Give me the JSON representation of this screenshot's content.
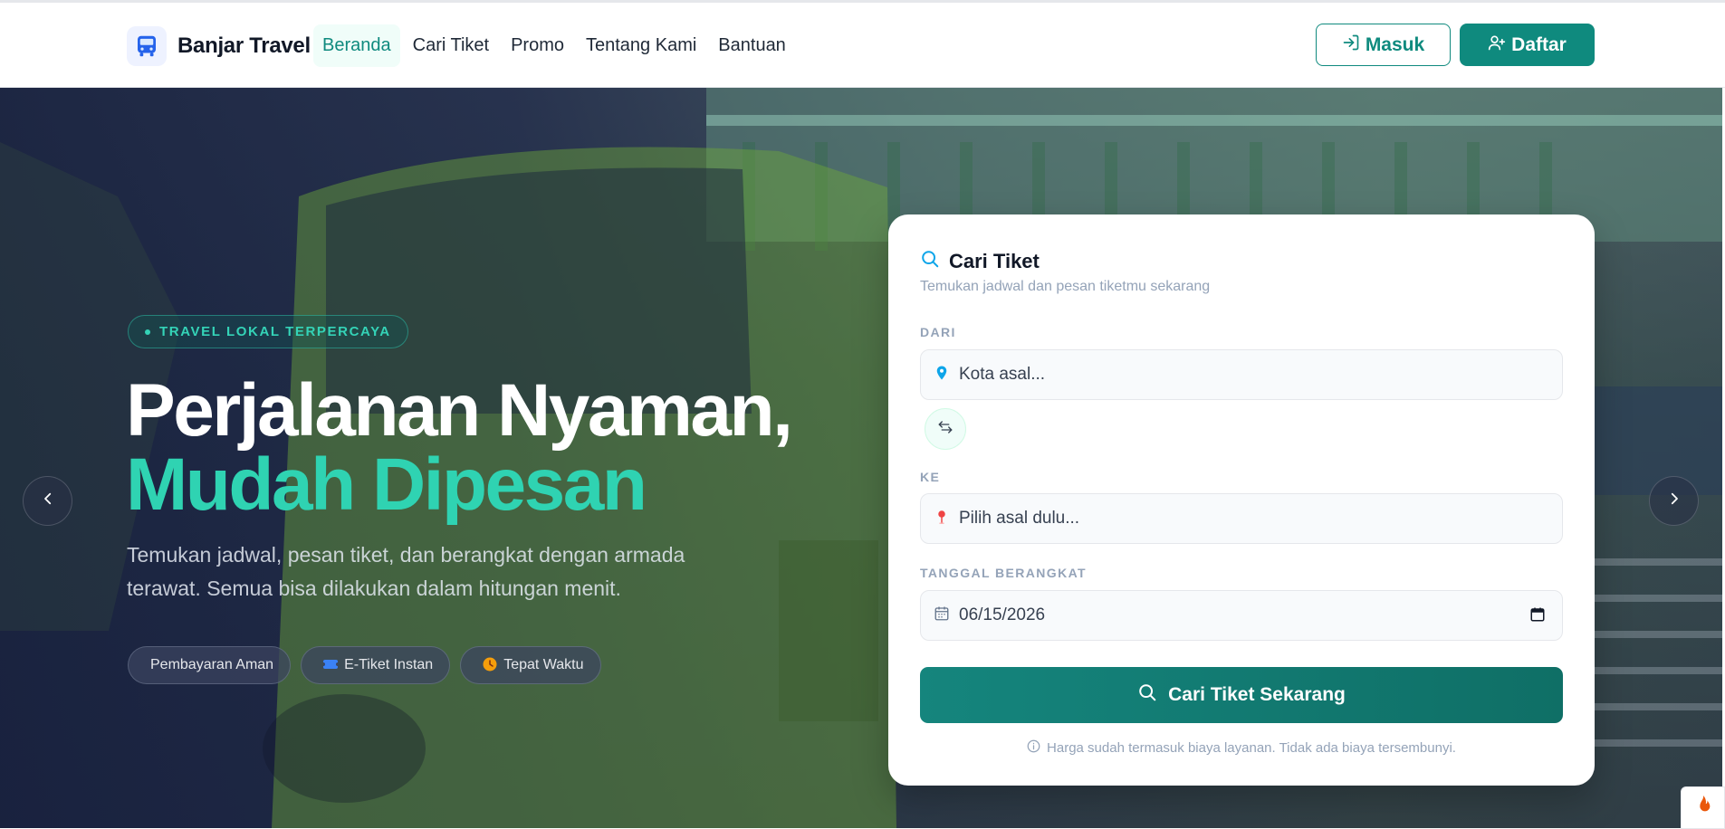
{
  "app": {
    "brand": "Banjar Travel"
  },
  "nav": {
    "items": [
      {
        "label": "Beranda",
        "active": true
      },
      {
        "label": "Cari Tiket",
        "active": false
      },
      {
        "label": "Promo",
        "active": false
      },
      {
        "label": "Tentang Kami",
        "active": false
      },
      {
        "label": "Bantuan",
        "active": false
      }
    ],
    "login_label": "Masuk",
    "register_label": "Daftar"
  },
  "hero": {
    "badge": "TRAVEL LOKAL TERPERCAYA",
    "title_line1": "Perjalanan Nyaman,",
    "title_line2": "Mudah Dipesan",
    "subtitle": "Temukan jadwal, pesan tiket, dan berangkat dengan armada terawat. Semua bisa dilakukan dalam hitungan menit.",
    "chips": [
      {
        "label": "Pembayaran Aman",
        "icon": "shield-icon"
      },
      {
        "label": "E-Tiket Instan",
        "icon": "ticket-icon"
      },
      {
        "label": "Tepat Waktu",
        "icon": "clock-icon"
      }
    ]
  },
  "search_card": {
    "title": "Cari Tiket",
    "subtitle": "Temukan jadwal dan pesan tiketmu sekarang",
    "from_label": "DARI",
    "from_placeholder": "Kota asal...",
    "to_label": "KE",
    "to_placeholder": "Pilih asal dulu...",
    "date_label": "TANGGAL BERANGKAT",
    "date_value": "06/15/2026",
    "submit_label": "Cari Tiket Sekarang",
    "note": "Harga sudah termasuk biaya layanan. Tidak ada biaya tersembunyi."
  },
  "colors": {
    "accent": "#0f8a7e",
    "accent_light": "#2fd3b2",
    "hero_overlay": "#1a2246"
  }
}
